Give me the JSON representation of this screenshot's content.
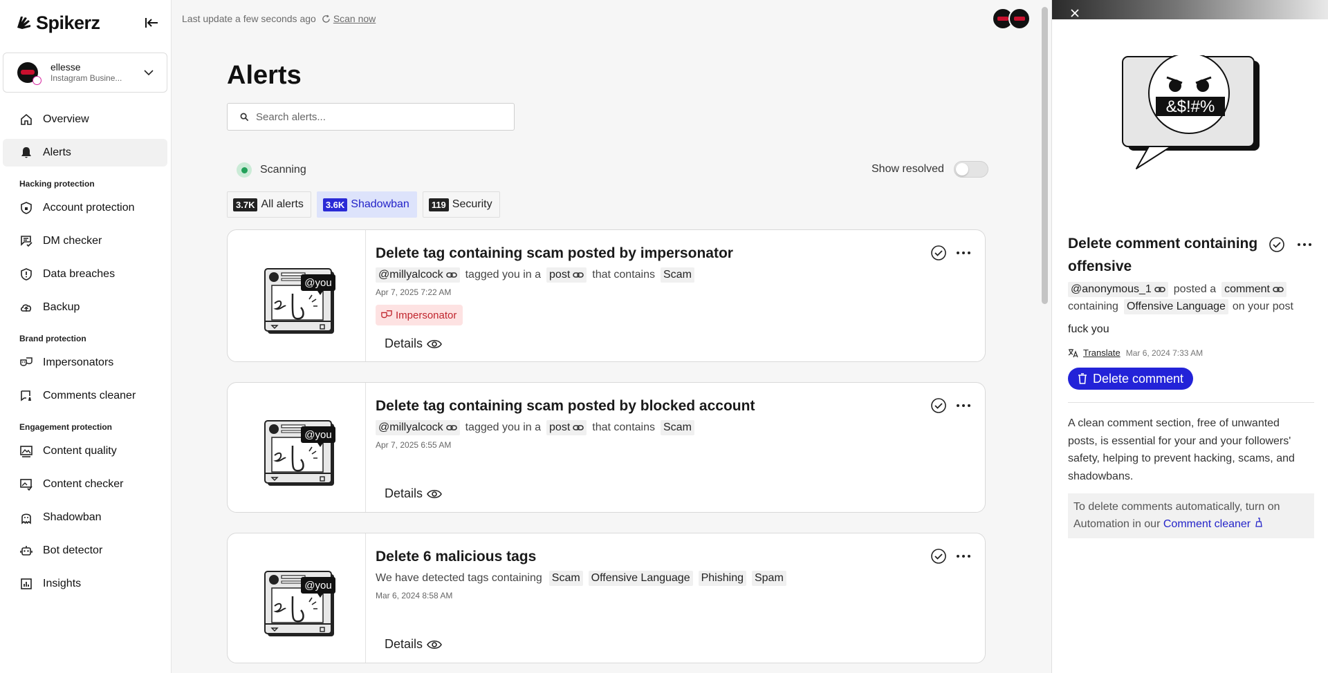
{
  "app": {
    "name": "Spikerz"
  },
  "account": {
    "name": "ellesse",
    "type": "Instagram Busine..."
  },
  "nav": {
    "overview": "Overview",
    "alerts": "Alerts",
    "section_hacking": "Hacking protection",
    "account_protection": "Account protection",
    "dm_checker": "DM checker",
    "data_breaches": "Data breaches",
    "backup": "Backup",
    "section_brand": "Brand protection",
    "impersonators": "Impersonators",
    "comments_cleaner": "Comments cleaner",
    "section_engagement": "Engagement protection",
    "content_quality": "Content quality",
    "content_checker": "Content checker",
    "shadowban": "Shadowban",
    "bot_detector": "Bot detector",
    "insights": "Insights"
  },
  "topbar": {
    "last_update": "Last update a few seconds ago",
    "scan_now": "Scan now"
  },
  "page": {
    "title": "Alerts",
    "search_placeholder": "Search alerts...",
    "scanning": "Scanning",
    "show_resolved": "Show resolved",
    "show_resolved_on": false
  },
  "tabs": [
    {
      "count": "3.7K",
      "label": "All alerts"
    },
    {
      "count": "3.6K",
      "label": "Shadowban"
    },
    {
      "count": "119",
      "label": "Security"
    }
  ],
  "active_tab": "Shadowban",
  "cards": [
    {
      "title": "Delete tag containing scam posted by impersonator",
      "user": "@millyalcock",
      "text1": "tagged you in a",
      "chip_post": "post",
      "text2": "that contains",
      "chip_scam": "Scam",
      "date": "Apr 7, 2025 7:22 AM",
      "badge": "Impersonator",
      "details": "Details",
      "illus_tag": "@you"
    },
    {
      "title": "Delete tag containing scam posted by blocked account",
      "user": "@millyalcock",
      "text1": "tagged you in a",
      "chip_post": "post",
      "text2": "that contains",
      "chip_scam": "Scam",
      "date": "Apr 7, 2025 6:55 AM",
      "details": "Details",
      "illus_tag": "@you"
    },
    {
      "title": "Delete 6 malicious tags",
      "text": "We have detected tags containing",
      "tags": [
        "Scam",
        "Offensive Language",
        "Phishing",
        "Spam"
      ],
      "date": "Mar 6, 2024 8:58 AM",
      "details": "Details",
      "illus_tag": "@you"
    }
  ],
  "panel": {
    "illus_text": "&$!#%",
    "title": "Delete comment containing offensive",
    "user": "@anonymous_1",
    "posted_a": "posted a",
    "chip_comment": "comment",
    "containing": "containing",
    "chip_category": "Offensive Language",
    "on_post": "on your post",
    "comment_text": "fuck you",
    "translate": "Translate",
    "date": "Mar 6, 2024 7:33 AM",
    "delete_button": "Delete comment",
    "description": "A clean comment section, free of unwanted posts, is essential for your and your followers' safety, helping to prevent hacking, scams, and shadowbans.",
    "note_prefix": "To delete comments automatically, turn on Automation in our",
    "note_link": "Comment cleaner"
  },
  "colors": {
    "accent": "#2323d8",
    "scanning": "#22a15a",
    "impersonator_bg": "#fde2e2",
    "impersonator_fg": "#c0252d",
    "active_tab_bg": "#dde3fb"
  }
}
